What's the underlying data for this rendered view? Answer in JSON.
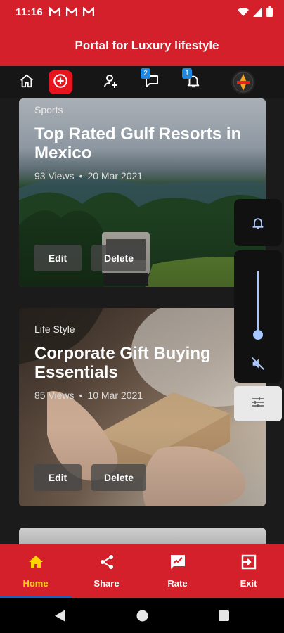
{
  "status_bar": {
    "time": "11:16",
    "notification_icons": [
      "gmail-icon",
      "gmail-icon",
      "gmail-icon"
    ],
    "system_icons": [
      "wifi-icon",
      "signal-icon",
      "battery-icon"
    ]
  },
  "app_bar": {
    "title": "Portal for Luxury lifestyle"
  },
  "toolbar": {
    "items": [
      {
        "name": "home-icon"
      },
      {
        "name": "add-icon"
      },
      {
        "name": "add-user-icon"
      },
      {
        "name": "chat-icon",
        "badge": "2"
      },
      {
        "name": "bell-icon",
        "badge": "1"
      },
      {
        "name": "avatar"
      }
    ]
  },
  "cards": [
    {
      "category": "Sports",
      "title": "Top Rated Gulf Resorts in Mexico",
      "views": "93 Views",
      "date": "20 Mar 2021",
      "edit_label": "Edit",
      "delete_label": "Delete"
    },
    {
      "category": "Life Style",
      "title": "Corporate Gift Buying Essentials",
      "views": "85 Views",
      "date": "10 Mar 2021",
      "edit_label": "Edit",
      "delete_label": "Delete"
    }
  ],
  "volume_panel": {
    "level": 0.25,
    "icons": [
      "bell-icon",
      "muted-icon",
      "settings-sliders-icon"
    ]
  },
  "bottom_nav": {
    "items": [
      {
        "label": "Home",
        "icon": "home-icon",
        "active": true
      },
      {
        "label": "Share",
        "icon": "share-icon",
        "active": false
      },
      {
        "label": "Rate",
        "icon": "rate-icon",
        "active": false
      },
      {
        "label": "Exit",
        "icon": "exit-icon",
        "active": false
      }
    ]
  },
  "colors": {
    "primary_red": "#d3202a",
    "active_label": "#ffd500",
    "badge_blue": "#1e88e5"
  }
}
